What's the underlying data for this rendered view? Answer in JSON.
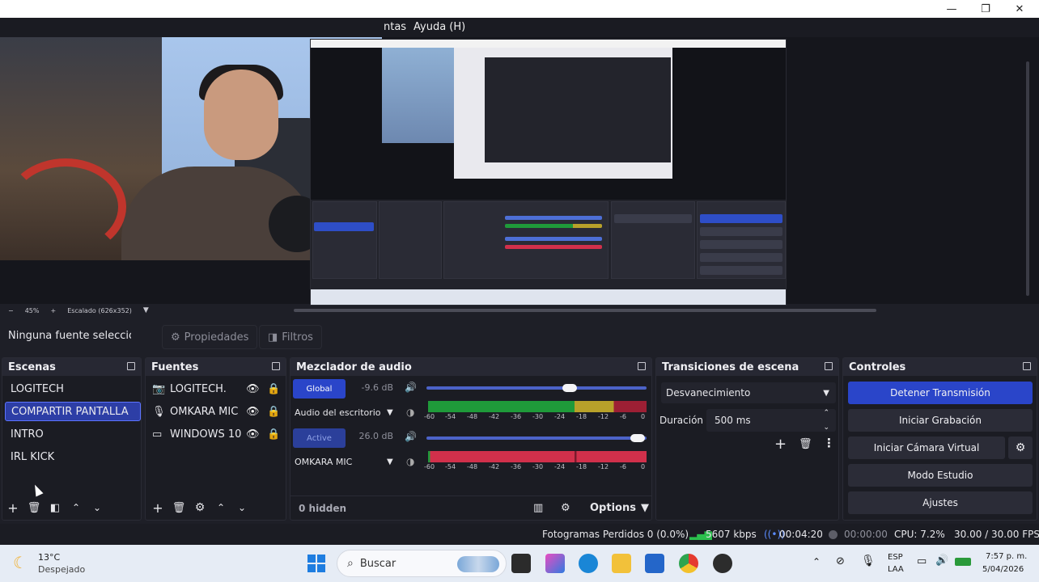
{
  "window": {
    "minimize_glyph": "—",
    "maximize_glyph": "❐",
    "close_glyph": "✕"
  },
  "menu": {
    "items": [
      "ntas",
      "Ayuda (H)"
    ]
  },
  "preview": {
    "zoom_minus": "−",
    "zoom_level": "45%",
    "zoom_plus": "+",
    "scale_label": "Escalado (626x352)"
  },
  "source_toolbar": {
    "no_source": "Ninguna fuente seleccionada",
    "properties": "Propiedades",
    "filters": "Filtros"
  },
  "scenes": {
    "title": "Escenas",
    "items": [
      "LOGITECH",
      "COMPARTIR PANTALLA",
      "INTRO",
      "IRL KICK"
    ],
    "selected_index": 1
  },
  "sources": {
    "title": "Fuentes",
    "items": [
      {
        "name": "LOGITECH.",
        "icon": "camera-icon"
      },
      {
        "name": "OMKARA MIC",
        "icon": "microphone-icon"
      },
      {
        "name": "WINDOWS 10",
        "icon": "monitor-icon"
      }
    ]
  },
  "mixer": {
    "title": "Mezclador de audio",
    "tracks": [
      {
        "badge": "Global",
        "db": "-9.6 dB",
        "name": "Audio del escritorio",
        "volume": 0.65
      },
      {
        "badge": "Active",
        "db": "26.0 dB",
        "name": "OMKARA MIC",
        "volume": 0.96
      }
    ],
    "ticks": [
      "-60",
      "-54",
      "-48",
      "-42",
      "-36",
      "-30",
      "-24",
      "-18",
      "-12",
      "-6",
      "0"
    ],
    "hidden": "0 hidden",
    "options": "Options"
  },
  "transitions": {
    "title": "Transiciones de escena",
    "selected": "Desvanecimiento",
    "duration_label": "Duración",
    "duration_value": "500 ms"
  },
  "controls": {
    "title": "Controles",
    "buttons": [
      "Detener Transmisión",
      "Iniciar Grabación",
      "Iniciar Cámara Virtual",
      "Modo Estudio",
      "Ajustes"
    ]
  },
  "status": {
    "dropped": "Fotogramas Perdidos 0 (0.0%)",
    "kbps": "5607 kbps",
    "stream_time": "00:04:20",
    "rec_time": "00:00:00",
    "cpu": "CPU: 7.2%",
    "fps": "30.00 / 30.00 FPS"
  },
  "taskbar": {
    "weather_temp": "13°C",
    "weather_desc": "Despejado",
    "search": "Buscar",
    "lang_top": "ESP",
    "lang_bottom": "LAA",
    "time": "7:57 p. m.",
    "date": "5/04/2026"
  },
  "colors": {
    "accent": "#2a45c9",
    "meter_green": "#1f9a3a",
    "meter_yellow": "#b8a12a",
    "meter_red": "#d1304b"
  }
}
